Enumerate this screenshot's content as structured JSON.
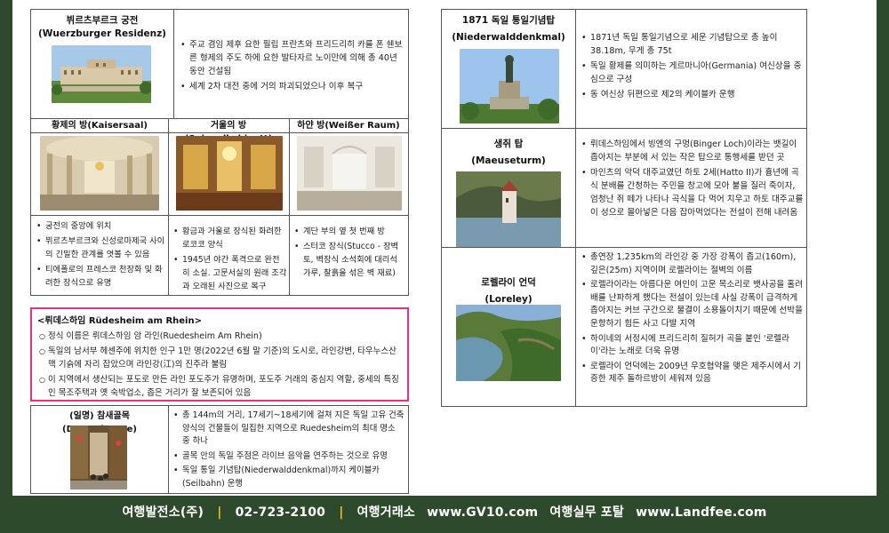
{
  "residenz": {
    "title": "뷔르츠부르크 궁전",
    "subtitle": "(Wuerzburger Residenz)",
    "bullets": [
      "주교 겸임 제후 요한 필립 프란츠와 프리드리히 카를 폰 쉔보른 형제의 주도 하에 요한 발타자르 노이만에 의해 총 40년 동안 건설됨",
      "세계 2차 대전 중에 거의 파괴되었으나 이후 복구"
    ]
  },
  "rooms": [
    {
      "title": "황제의 방(Kaisersaal)",
      "bullets": [
        "궁전의 중앙에 위치",
        "뷔르츠부르크와 신성로마제국 사이의 긴밀한 관계를 엿볼 수 있음",
        "티에폴로의 프레스코 천장화 및 화려한 장식으로 유명"
      ]
    },
    {
      "title": "거울의 방(Spiegelkabinett)",
      "bullets": [
        "황금과 거울로 장식된 화려한 로코코 양식",
        "1945년 야간 폭격으로 완전히 소실. 고문서실의 원래 조각과 오래된 사진으로 복구"
      ]
    },
    {
      "title": "하얀 방(Weißer Raum)",
      "bullets": [
        "계단 부의 옆 첫 번째 방",
        "스터코 장식(Stucco - 장벽토, 벽장식 소석회에 대리석 가루, 찰흙을 섞은 벽 재료)"
      ]
    }
  ],
  "ruedesheim": {
    "title": "<뤼데스하임 Rüdesheim am Rhein>",
    "bullets": [
      "정식 이름은 뤼데스하임 암 라인(Ruedesheim Am Rhein)",
      "독일의 남서부 헤센주에 위치한 인구 1만 명(2022년 6월 말 기준)의 도시로, 라인강변, 타우누스산맥 기슭에 자리 잡았으며 라인강(江)의 진주라 불림",
      "이 지역에서 생산되는 포도로 만든 라인 포도주가 유명하며, 포도주 거래의 중심지 역할, 중세의 특징인 목조주택과 옛 숙박업소, 좁은 거리가 잘 보존되어 있음"
    ]
  },
  "drosselgasse": {
    "title": "(일명) 참새골목 (Drosselgasse)",
    "bullets": [
      "총 144m의 거리, 17세기~18세기에 걸쳐 지은 독일 고유 건축양식의 건물들이 밀집한 지역으로 Ruedesheim의 최대 명소 중 하나",
      "골목 안의 독일 주점은 라이브 음악을 연주하는 것으로 유명",
      "독일 통일 기념탑(Niederwalddenkmal)까지 케이블카(Seilbahn) 운행"
    ]
  },
  "niederwald": {
    "title": "1871 독일 통일기념탑",
    "subtitle": "(Niederwalddenkmal)",
    "bullets": [
      "1871년 독일 통일기념으로 세운 기념탑으로 총 높이 38.18m, 무게 총 75t",
      "독일 황제를 의미하는 게르마니아(Germania) 여신상을 중심으로 구성",
      "동 여신상 뒤편으로 제2의 케이블카 운행"
    ]
  },
  "maeuseturm": {
    "title": "생쥐 탑",
    "subtitle": "(Maeuseturm)",
    "bullets": [
      "뤼데스하임에서 빙엔의 구멍(Binger Loch)이라는 뱃길이 좁아지는 부분에 서 있는 작은 탑으로 통행세를 받던 곳",
      "마인츠의 악덕 대주교였던 하토 2세(Hatto II)가 흉년에 곡식 분배를 간청하는 주민을 창고에 모아 불을 질러 죽이자, 엄청난 쥐 떼가 나타나 곡식을 다 먹어 치우고 하토 대주교를 이 성으로 몰아넣은 다음 잡아먹었다는 전설이 전해 내려옴"
    ]
  },
  "loreley": {
    "title": "로렐라이 언덕",
    "subtitle": "(Loreley)",
    "bullets": [
      "총연장 1,235km의 라인강 중 가장 강폭이 좁고(160m), 깊은(25m) 지역이며 로렐라이는 절벽의 이름",
      "로렐라이라는 아름다운 여인이 고운 목소리로 뱃사공을 홀려 배를 난파하게 했다는 전설이 있는데 사실 강폭이 급격하게 좁아지는 커브 구간으로 물결이 소용돌이치기 때문에 선박을 운항하기 힘든 사고 다발 지역",
      "하이네의 서정시에 프리드리히 질허가 곡을 붙인 '로렐라이'라는 노래로 더욱 유명",
      "로렐라이 언덕에는 2009년 우호협약을 맺은 제주시에서 기증한 제주 돌하르방이 세워져 있음"
    ]
  },
  "footer": {
    "company": "여행발전소(주)",
    "phone": "02-723-2100",
    "exchange": "여행거래소",
    "url1": "www.GV10.com",
    "portal": "여행실무 포탈",
    "url2": "www.Landfee.com",
    "sep": "|"
  },
  "colors": {
    "background": "#2e4a2c",
    "highlight_border": "#e0338f",
    "separator": "#f0c020"
  }
}
